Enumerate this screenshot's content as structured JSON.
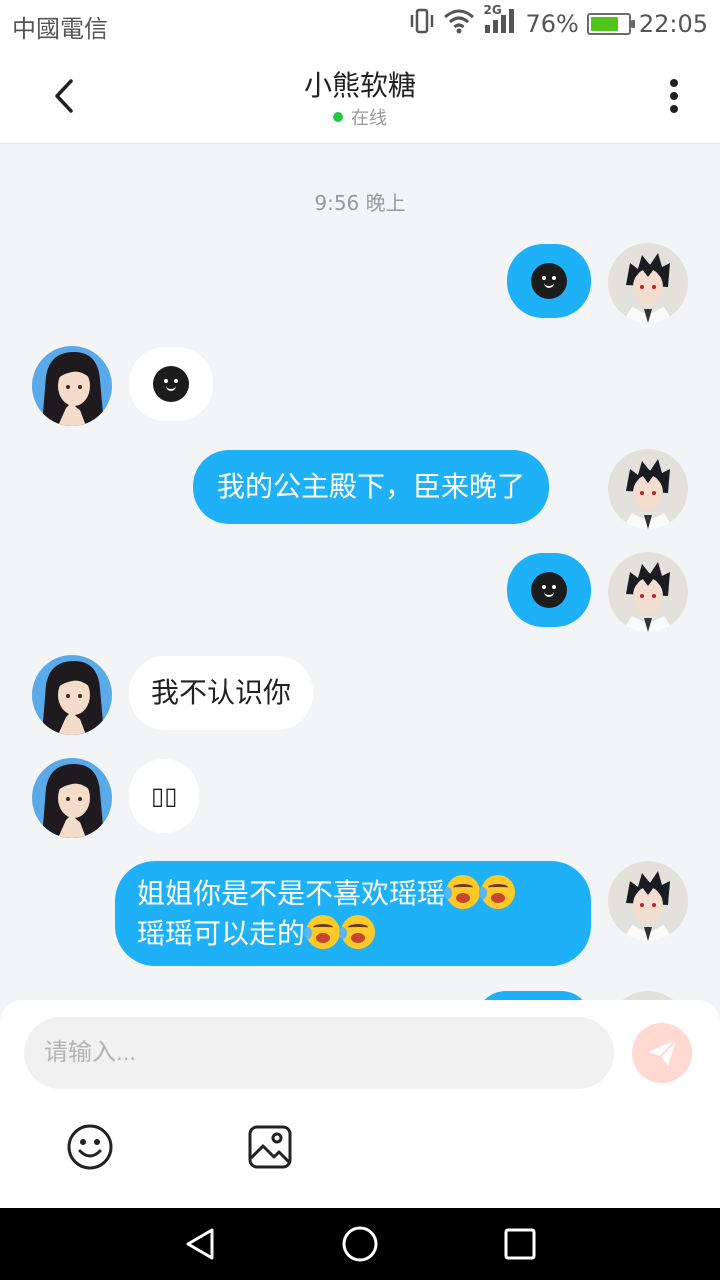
{
  "status_bar": {
    "carrier": "中國電信",
    "network": "2G",
    "battery_percent": "76%",
    "battery_level": 0.76,
    "time": "22:05",
    "icons": [
      "vibrate-icon",
      "wifi-icon",
      "signal-icon",
      "battery-icon"
    ]
  },
  "header": {
    "title": "小熊软糖",
    "status": "在线",
    "status_color": "#26c64a",
    "back_icon": "chevron-left-icon",
    "more_icon": "more-vertical-icon"
  },
  "chat": {
    "timestamp": "9:56 晚上",
    "messages": [
      {
        "from": "me",
        "type": "sticker",
        "sticker": "black-face-sticker"
      },
      {
        "from": "her",
        "type": "sticker",
        "sticker": "black-face-sticker"
      },
      {
        "from": "me",
        "type": "text",
        "text": "我的公主殿下，臣来晚了"
      },
      {
        "from": "me",
        "type": "sticker",
        "sticker": "black-face-sticker"
      },
      {
        "from": "her",
        "type": "text",
        "text": "我不认识你"
      },
      {
        "from": "her",
        "type": "text",
        "text": "▯▯"
      },
      {
        "from": "me",
        "type": "text",
        "line1": "姐姐你是不是不喜欢瑶瑶",
        "line2": "瑶瑶可以走的",
        "emoji": "crying-face-emoji"
      }
    ]
  },
  "composer": {
    "placeholder": "请输入...",
    "value": "",
    "send_icon": "paper-plane-icon",
    "send_color": "#ffd9d2",
    "tools": [
      "smile-icon",
      "image-icon"
    ]
  },
  "colors": {
    "outgoing_bubble": "#1eb1f7",
    "incoming_bubble": "#ffffff",
    "chat_background": "#f3f4f6"
  },
  "nav_bar": {
    "buttons": [
      "back-triangle-icon",
      "home-circle-icon",
      "recents-square-icon"
    ]
  }
}
